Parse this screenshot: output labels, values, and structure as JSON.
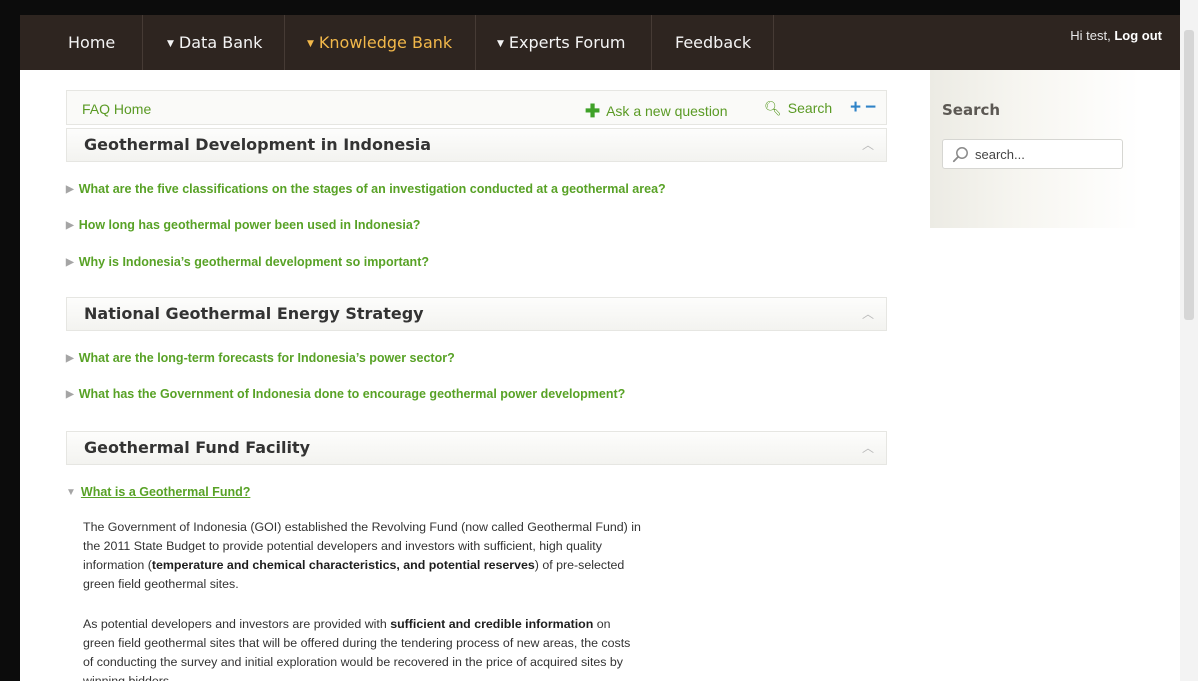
{
  "nav": {
    "home": "Home",
    "data_bank": "Data Bank",
    "knowledge_bank": "Knowledge Bank",
    "experts_forum": "Experts Forum",
    "feedback": "Feedback"
  },
  "user": {
    "greeting": "Hi test,",
    "logout": "Log out"
  },
  "faq_bar": {
    "home": "FAQ Home",
    "ask": "Ask a new question",
    "search": "Search",
    "expand_all": "+",
    "collapse_all": "−"
  },
  "sections": [
    {
      "title": "Geothermal Development in Indonesia",
      "questions": [
        "What are the five classifications on the stages of an investigation conducted at a geothermal area?",
        "How long has geothermal power been used in Indonesia?",
        "Why is Indonesia’s geothermal development so important?"
      ]
    },
    {
      "title": "National Geothermal Energy Strategy",
      "questions": [
        "What are the long-term forecasts for Indonesia’s power sector?",
        "What has the Government of Indonesia done to encourage geothermal power development?"
      ]
    },
    {
      "title": "Geothermal Fund Facility",
      "questions": [
        "What is a Geothermal Fund?"
      ]
    }
  ],
  "answer": {
    "p1_a": "The Government of Indonesia (GOI) established the Revolving Fund (now called Geothermal Fund) in the 2011 State Budget to provide potential developers and investors with sufficient, high quality information (",
    "p1_bold": "temperature and chemical characteristics, and potential reserves",
    "p1_b": ") of pre-selected green field geothermal sites.",
    "p2_a": "As potential developers and investors  are provided with ",
    "p2_bold": "sufficient and credible information",
    "p2_b": " on green field geothermal sites that will be offered during the tendering process of new areas, the costs of conducting the survey and initial exploration would be recovered in the price of acquired sites by winning bidders."
  },
  "sidebar": {
    "title": "Search",
    "placeholder": "search..."
  }
}
